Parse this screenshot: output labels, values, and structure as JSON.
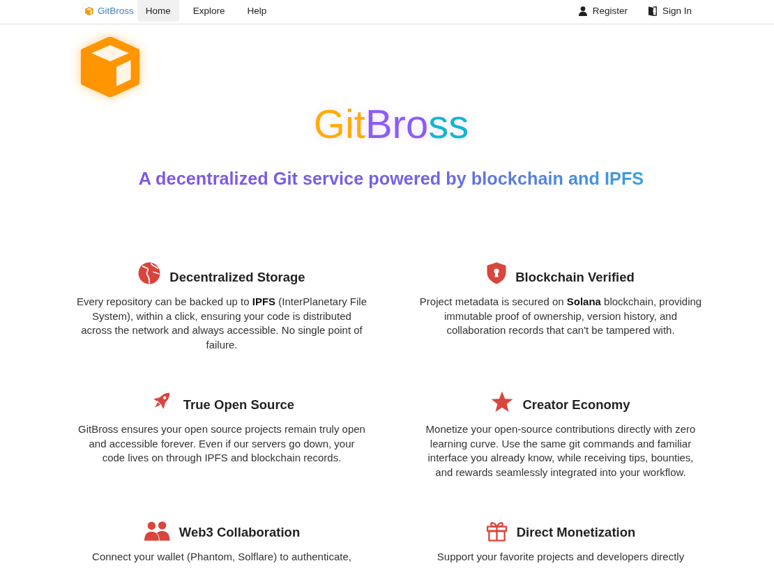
{
  "nav": {
    "brand": "GitBross",
    "items": [
      {
        "label": "Home",
        "selected": true
      },
      {
        "label": "Explore",
        "selected": false
      },
      {
        "label": "Help",
        "selected": false
      }
    ],
    "account_links": [
      {
        "kind": "register",
        "label": "Register"
      },
      {
        "kind": "sign_in",
        "label": "Sign In"
      }
    ]
  },
  "hero": {
    "title": "GitBross",
    "tagline": "A decentralized Git service powered by blockchain and IPFS"
  },
  "features": [
    {
      "kind": "globe",
      "title": "Decentralized Storage",
      "text": "Every repository can be backed up to **IPFS** (InterPlanetary File System), within a click, ensuring your code is distributed across the network and always accessible. No single point of failure."
    },
    {
      "kind": "shield",
      "title": "Blockchain Verified",
      "text": "Project metadata is secured on **Solana** blockchain, providing immutable proof of ownership, version history, and collaboration records that can't be tampered with."
    },
    {
      "kind": "rocket",
      "title": "True Open Source",
      "text": "GitBross ensures your open source projects remain truly open and accessible forever. Even if our servers go down, your code lives on through IPFS and blockchain records."
    },
    {
      "kind": "star",
      "title": "Creator Economy",
      "text": "Monetize your open-source contributions directly with zero learning curve. Use the same git commands and familiar interface you already know, while receiving tips, bounties, and rewards seamlessly integrated into your workflow."
    },
    {
      "kind": "users",
      "title": "Web3 Collaboration",
      "text": "Connect your wallet (Phantom, Solflare) to authenticate,"
    },
    {
      "kind": "gift",
      "title": "Direct Monetization",
      "text": "Support your favorite projects and developers directly"
    }
  ]
}
